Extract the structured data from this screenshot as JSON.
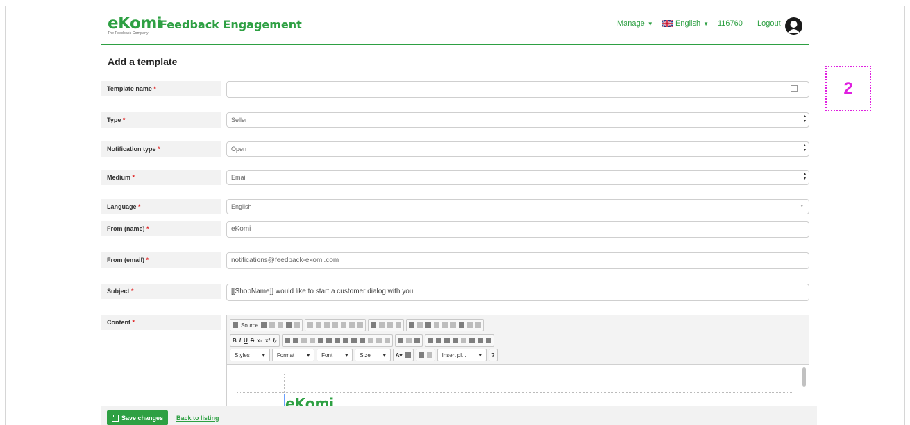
{
  "header": {
    "logo": "eKomi",
    "logo_sub": "The Feedback Company",
    "title": "Feedback Engagement",
    "manage": "Manage",
    "language": "English",
    "account_id": "116760",
    "logout": "Logout"
  },
  "page_title": "Add a template",
  "annotation": "2",
  "form": {
    "required_mark": "*",
    "template_name": {
      "label": "Template name",
      "value": ""
    },
    "type": {
      "label": "Type",
      "value": "Seller"
    },
    "notification_type": {
      "label": "Notification type",
      "value": "Open"
    },
    "medium": {
      "label": "Medium",
      "value": "Email"
    },
    "language": {
      "label": "Language",
      "value": "English"
    },
    "from_name": {
      "label": "From (name)",
      "value": "eKomi"
    },
    "from_email": {
      "label": "From (email)",
      "value": "notifications@feedback-ekomi.com"
    },
    "subject": {
      "label": "Subject",
      "value": "[[ShopName]] would like to start a customer dialog with you"
    },
    "content": {
      "label": "Content"
    }
  },
  "editor": {
    "source": "Source",
    "styles": "Styles",
    "format": "Format",
    "font": "Font",
    "size": "Size",
    "insert": "Insert pl...",
    "help": "?",
    "content_logo": "eKomi"
  },
  "footer": {
    "save": "Save changes",
    "back": "Back to listing"
  },
  "colors": {
    "brand": "#2ea043",
    "annotation": "#e020e0",
    "required": "#e02020"
  }
}
